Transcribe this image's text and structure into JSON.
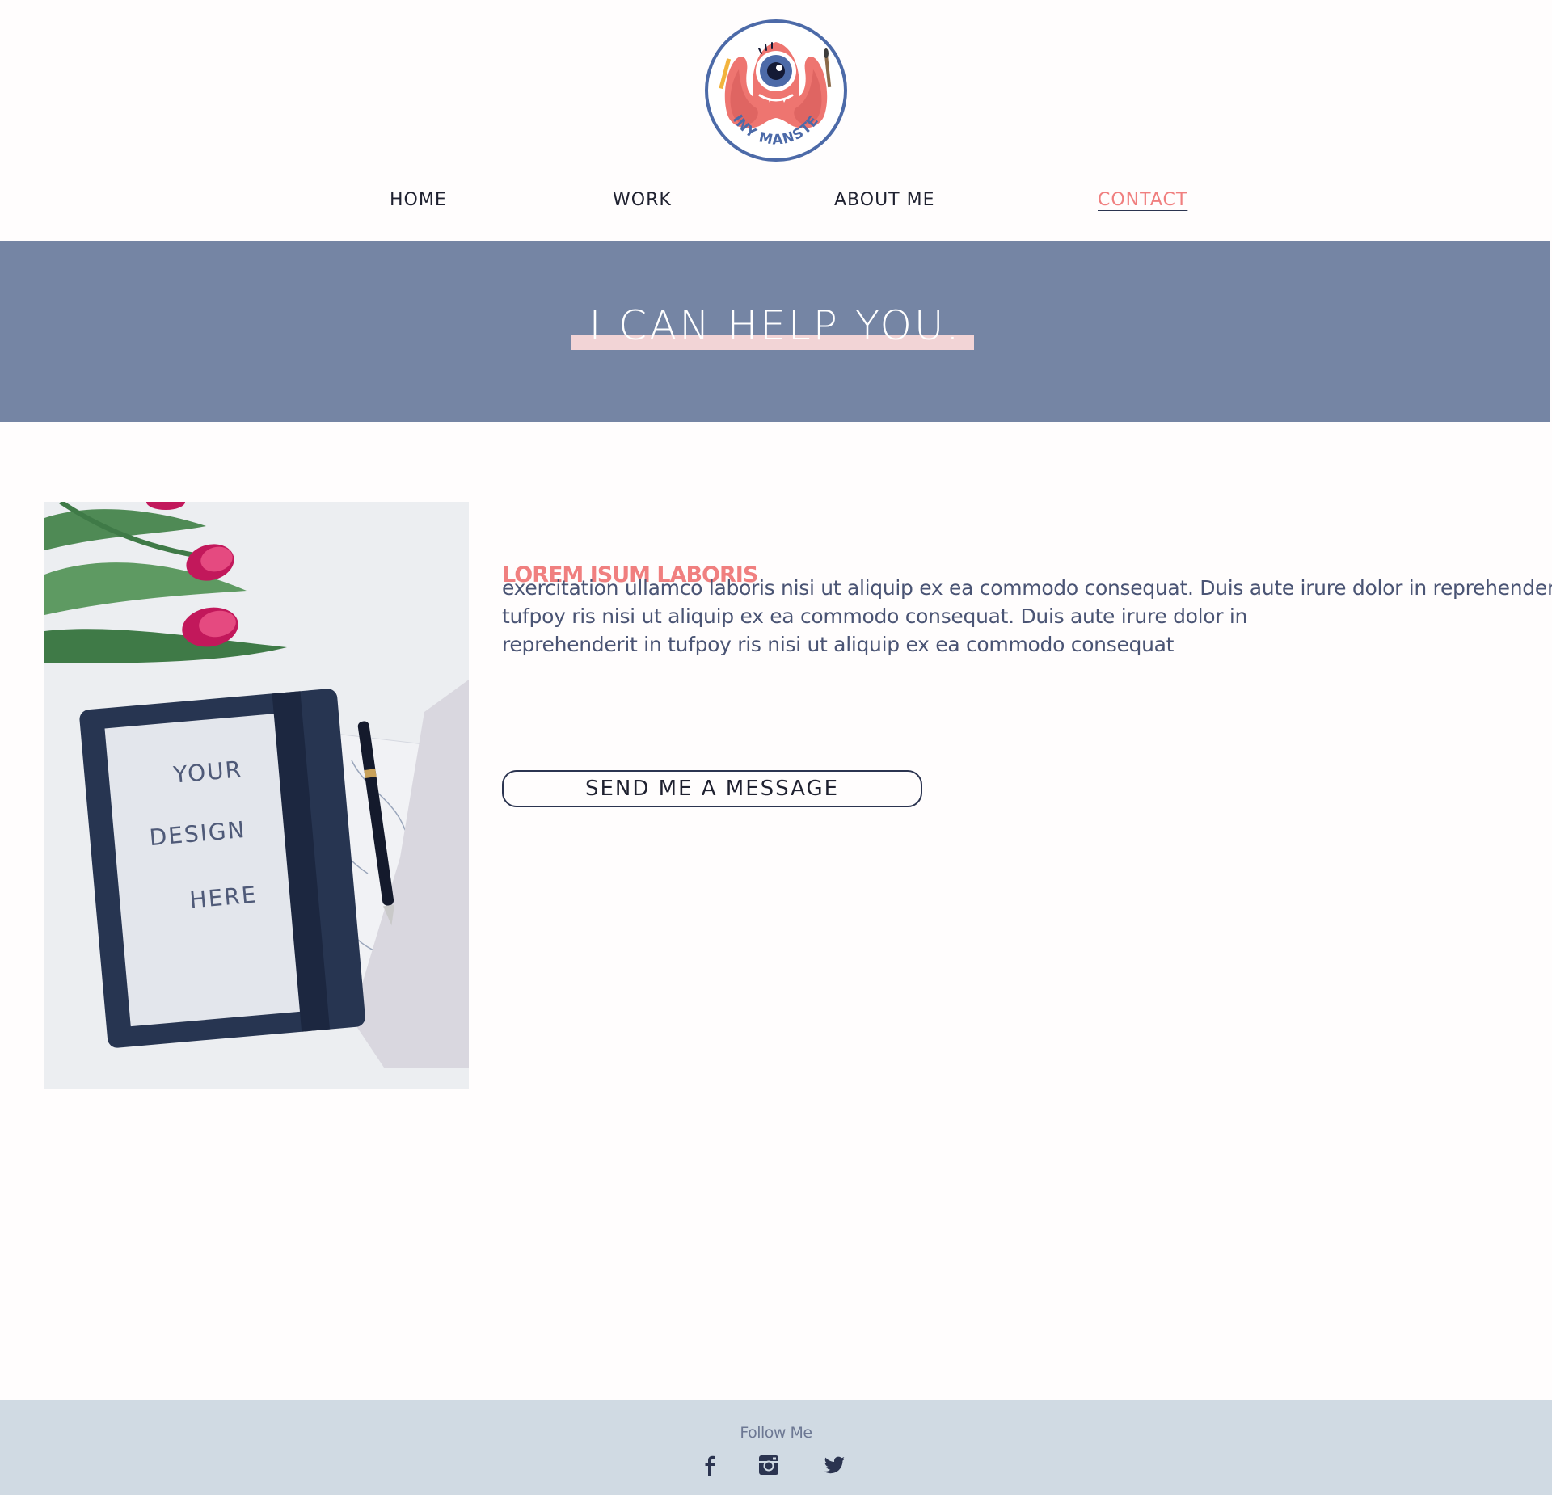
{
  "brand": {
    "logo_text": "TINY MANSTER",
    "colors": {
      "accent": "#f07f7f",
      "navy": "#2b3450",
      "banner": "#7585a4",
      "highlight": "#f2d4d6",
      "footer": "#d0dae3"
    }
  },
  "nav": {
    "items": [
      {
        "label": "HOME",
        "active": false
      },
      {
        "label": "WORK",
        "active": false
      },
      {
        "label": "ABOUT ME",
        "active": false
      },
      {
        "label": "CONTACT",
        "active": true
      }
    ]
  },
  "banner": {
    "title": "I CAN HELP YOU."
  },
  "photo": {
    "note_lines": [
      "YOUR",
      "DESIGN",
      "HERE"
    ]
  },
  "content": {
    "heading": "LOREM ISUM LABORIS",
    "paragraph_lines": [
      "exercitation ullamco laboris nisi ut aliquip ex ea commodo consequat. Duis aute irure dolor in reprehenderit in",
      "tufpoy ris nisi ut aliquip ex ea commodo consequat. Duis aute irure dolor in",
      "reprehenderit in tufpoy ris nisi ut aliquip ex ea commodo consequat"
    ],
    "button_label": "SEND ME A MESSAGE"
  },
  "footer": {
    "follow_label": "Follow Me",
    "social_icons": [
      "facebook-icon",
      "instagram-icon",
      "twitter-icon"
    ]
  }
}
